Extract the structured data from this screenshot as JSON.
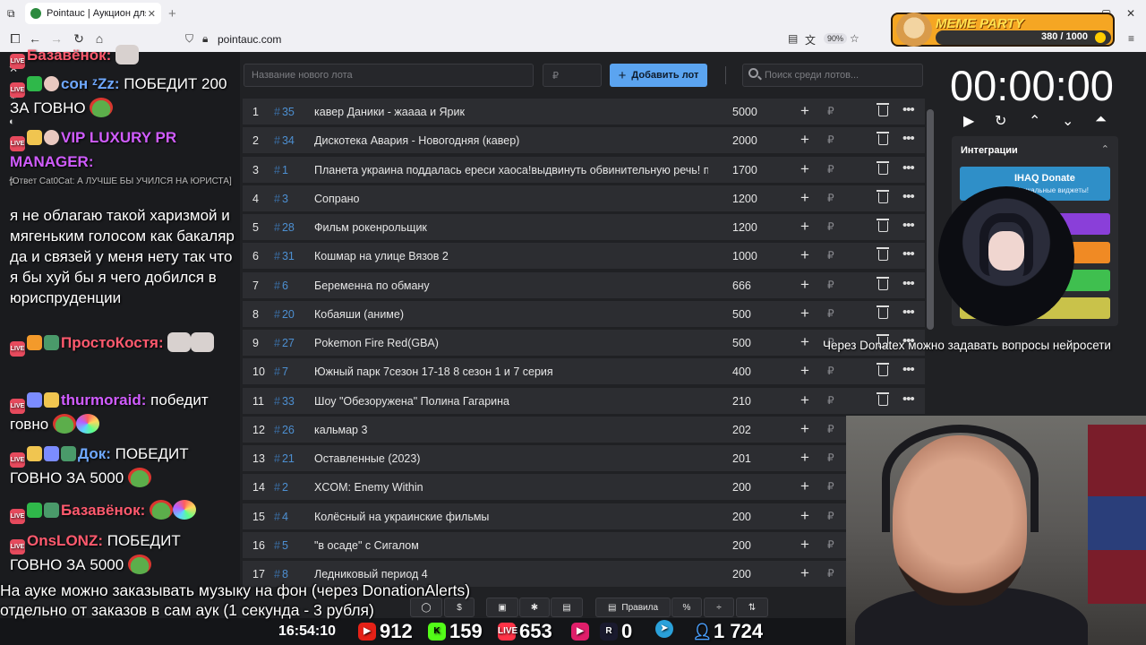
{
  "browser": {
    "tab_title": "Pointauc | Аукцион для стримеров",
    "url": "pointauc.com",
    "zoom": "90%"
  },
  "meme_party": {
    "title": "MEME PARTY",
    "count": "380 / 1000"
  },
  "toolbar": {
    "lot_placeholder": "Название нового лота",
    "price_placeholder": "₽",
    "add_label": "Добавить лот",
    "search_placeholder": "Поиск среди лотов..."
  },
  "lots": [
    {
      "n": "1",
      "id": "35",
      "name": "кавер Даники - жаааа и Ярик",
      "amount": "5000"
    },
    {
      "n": "2",
      "id": "34",
      "name": "Дискотека Авария - Новогодняя (кавер)",
      "amount": "2000"
    },
    {
      "n": "3",
      "id": "1",
      "name": "Планета украина поддалась ереси хаоса!выдвинуть обвинительную речь! по",
      "amount": "1700"
    },
    {
      "n": "4",
      "id": "3",
      "name": "Сопрано",
      "amount": "1200"
    },
    {
      "n": "5",
      "id": "28",
      "name": "Фильм рокенрольщик",
      "amount": "1200"
    },
    {
      "n": "6",
      "id": "31",
      "name": "Кошмар на улице Вязов 2",
      "amount": "1000"
    },
    {
      "n": "7",
      "id": "6",
      "name": "Беременна по обману",
      "amount": "666"
    },
    {
      "n": "8",
      "id": "20",
      "name": "Кобаяши (аниме)",
      "amount": "500"
    },
    {
      "n": "9",
      "id": "27",
      "name": "Pokemon Fire Red(GBA)",
      "amount": "500"
    },
    {
      "n": "10",
      "id": "7",
      "name": "Южный парк 7сезон 17-18 8 сезон 1 и 7 серия",
      "amount": "400"
    },
    {
      "n": "11",
      "id": "33",
      "name": "Шоу \"Обезоружена\" Полина Гагарина",
      "amount": "210"
    },
    {
      "n": "12",
      "id": "26",
      "name": "кальмар 3",
      "amount": "202"
    },
    {
      "n": "13",
      "id": "21",
      "name": "Оставленные (2023)",
      "amount": "201"
    },
    {
      "n": "14",
      "id": "2",
      "name": "XCOM: Enemy Within",
      "amount": "200"
    },
    {
      "n": "15",
      "id": "4",
      "name": "Колёсный на украинские фильмы",
      "amount": "200"
    },
    {
      "n": "16",
      "id": "5",
      "name": "\"в осаде\" с Сигалом",
      "amount": "200"
    },
    {
      "n": "17",
      "id": "8",
      "name": "Ледниковый период 4",
      "amount": "200"
    }
  ],
  "timer": {
    "value": "00:00:00"
  },
  "integrations": {
    "title": "Интеграции",
    "ihaq_title": "IHAQ Donate",
    "ihaq_sub": "Уникальные виджеты!",
    "fourth_label": "uet"
  },
  "chat": {
    "l1_name": "Базавёнок:",
    "l2_name": "сон ᶻZz:",
    "l2_text": "ПОБЕДИТ 200 ЗА ГОВНО",
    "l3_name": "VIP LUXURY PR MANAGER:",
    "l4_reply": "[Ответ Cat0Cat: А ЛУЧШЕ БЫ УЧИЛСЯ НА ЮРИСТА]",
    "l5_text": "я не облагаю такой харизмой и мягеньким голосом как бакаляр да и связей у меня нету так что я бы хуй бы я чего добился в юриспруденции",
    "l6_name": "ПростоКостя:",
    "l7_name": "thurmoraid:",
    "l7_text": "победит говно",
    "l8_name": "Док:",
    "l8_text": "ПОБЕДИТ ГОВНО ЗА 5000",
    "l9_name": "Базавёнок:",
    "l10_name": "OnsLONZ:",
    "l10_text": "ПОБЕДИТ ГОВНО ЗА 5000"
  },
  "ticker_text": "Через Donatex можно задавать вопросы нейросети",
  "subtitle": {
    "line1": "На ауке можно заказывать музыку на фон (через DonationAlerts)",
    "line2": "отдельно от заказов в сам аук (1 секунда - 3 рубля)"
  },
  "bottom_buttons": {
    "rules_label": "Правила"
  },
  "stats": {
    "clock": "16:54:10",
    "youtube": "912",
    "kick": "159",
    "vklive": "653",
    "rutube": "0",
    "telegram": "",
    "viewers": "1 724"
  },
  "colors": {
    "accent": "#5ba4f0",
    "row_bg": "#2c2d31",
    "id_blue": "#4d8fd1"
  }
}
